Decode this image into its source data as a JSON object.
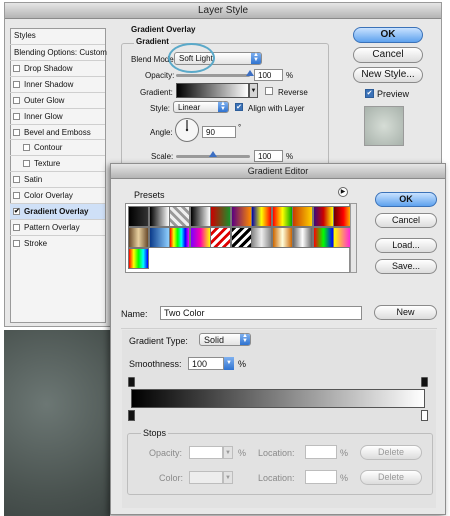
{
  "layer_style": {
    "title": "Layer Style",
    "styles_header": "Styles",
    "sidebar_items": [
      {
        "label": "Blending Options: Custom",
        "checkbox": false,
        "checked": false,
        "selected": false,
        "indent": false
      },
      {
        "label": "Drop Shadow",
        "checkbox": true,
        "checked": false,
        "selected": false,
        "indent": false
      },
      {
        "label": "Inner Shadow",
        "checkbox": true,
        "checked": false,
        "selected": false,
        "indent": false
      },
      {
        "label": "Outer Glow",
        "checkbox": true,
        "checked": false,
        "selected": false,
        "indent": false
      },
      {
        "label": "Inner Glow",
        "checkbox": true,
        "checked": false,
        "selected": false,
        "indent": false
      },
      {
        "label": "Bevel and Emboss",
        "checkbox": true,
        "checked": false,
        "selected": false,
        "indent": false
      },
      {
        "label": "Contour",
        "checkbox": true,
        "checked": false,
        "selected": false,
        "indent": true
      },
      {
        "label": "Texture",
        "checkbox": true,
        "checked": false,
        "selected": false,
        "indent": true
      },
      {
        "label": "Satin",
        "checkbox": true,
        "checked": false,
        "selected": false,
        "indent": false
      },
      {
        "label": "Color Overlay",
        "checkbox": true,
        "checked": false,
        "selected": false,
        "indent": false
      },
      {
        "label": "Gradient Overlay",
        "checkbox": true,
        "checked": true,
        "selected": true,
        "indent": false
      },
      {
        "label": "Pattern Overlay",
        "checkbox": true,
        "checked": false,
        "selected": false,
        "indent": false
      },
      {
        "label": "Stroke",
        "checkbox": true,
        "checked": false,
        "selected": false,
        "indent": false
      }
    ],
    "section_title": "Gradient Overlay",
    "group_title": "Gradient",
    "blend_mode_label": "Blend Mode:",
    "blend_mode_value": "Soft Light",
    "opacity_label": "Opacity:",
    "opacity_value": "100",
    "opacity_level": 1.0,
    "percent": "%",
    "gradient_label": "Gradient:",
    "reverse_label": "Reverse",
    "reverse_checked": false,
    "style_label": "Style:",
    "style_value": "Linear",
    "align_label": "Align with Layer",
    "align_checked": true,
    "angle_label": "Angle:",
    "angle_value": "90",
    "degree": "°",
    "scale_label": "Scale:",
    "scale_value": "100",
    "scale_level": 0.5,
    "ok_label": "OK",
    "cancel_label": "Cancel",
    "new_style_label": "New Style...",
    "preview_label": "Preview",
    "preview_checked": true
  },
  "gradient_editor": {
    "title": "Gradient Editor",
    "presets_label": "Presets",
    "ok_label": "OK",
    "cancel_label": "Cancel",
    "load_label": "Load...",
    "save_label": "Save...",
    "name_label": "Name:",
    "name_value": "Two Color",
    "new_label": "New",
    "gradient_type_label": "Gradient Type:",
    "gradient_type_value": "Solid",
    "smoothness_label": "Smoothness:",
    "smoothness_value": "100",
    "percent": "%",
    "stops_label": "Stops",
    "stop_opacity_label": "Opacity:",
    "stop_color_label": "Color:",
    "location_label": "Location:",
    "delete_label": "Delete",
    "colors": {
      "accent": "#3b72b8",
      "gradient_start": "#000000",
      "gradient_end": "#ffffff",
      "titlebar": "#c9c9c9",
      "dialog_bg": "#e8e8e8"
    }
  }
}
